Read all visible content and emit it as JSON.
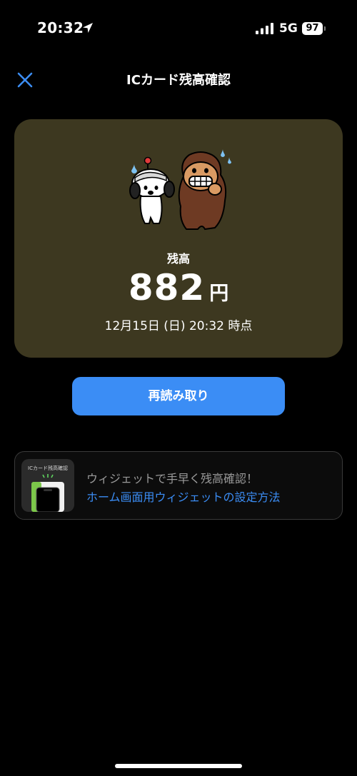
{
  "status_bar": {
    "time": "20:32",
    "network": "5G",
    "battery": "97"
  },
  "header": {
    "title": "ICカード残高確認"
  },
  "balance_card": {
    "label": "残高",
    "amount": "882",
    "unit": "円",
    "timestamp": "12月15日 (日) 20:32 時点"
  },
  "actions": {
    "reread_label": "再読み取り"
  },
  "widget_promo": {
    "thumbnail_title": "ICカード残高確認",
    "text": "ウィジェットで手早く残高確認！",
    "link": "ホーム画面用ウィジェットの設定方法"
  },
  "colors": {
    "background": "#000000",
    "card": "#3d3820",
    "accent": "#3b8df5"
  }
}
